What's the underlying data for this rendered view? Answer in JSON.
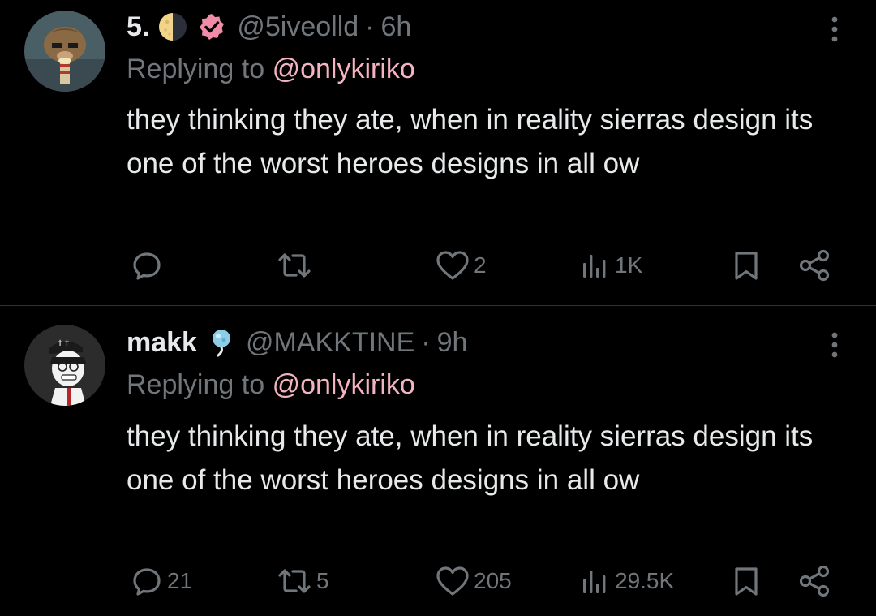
{
  "tweets": [
    {
      "display_name": "5.",
      "name_emoji": "moon-icon",
      "verified": true,
      "handle": "@5iveolld",
      "separator": "·",
      "time": "6h",
      "replying_prefix": "Replying to",
      "replying_to": "@onlykiriko",
      "text": "they thinking they ate, when in reality sierras design its one of the worst heroes designs in all ow",
      "actions": {
        "replies": "",
        "reposts": "",
        "likes": "2",
        "views": "1K"
      }
    },
    {
      "display_name": "makk",
      "name_emoji": "cotton-candy-icon",
      "verified": false,
      "handle": "@MAKKTINE",
      "separator": "·",
      "time": "9h",
      "replying_prefix": "Replying to",
      "replying_to": "@onlykiriko",
      "text": "they thinking they ate, when in reality sierras design its one of the worst heroes designs in all ow",
      "actions": {
        "replies": "21",
        "reposts": "5",
        "likes": "205",
        "views": "29.5K"
      }
    }
  ],
  "colors": {
    "background": "#000000",
    "primary_text": "#e7e9ea",
    "secondary_text": "#71767b",
    "mention": "#f4b3c0",
    "verified_badge": "#f08ca8",
    "divider": "#2f3336"
  }
}
